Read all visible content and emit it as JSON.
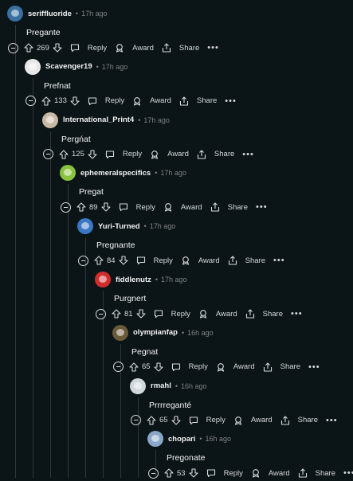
{
  "labels": {
    "reply": "Reply",
    "award": "Award",
    "share": "Share",
    "more": "•••",
    "sep": "•"
  },
  "comments": [
    {
      "user": "seriffluoride",
      "time": "17h ago",
      "text": "Pregante",
      "score": "269",
      "avatar_color": "#3a6fa0"
    },
    {
      "user": "Scavenger19",
      "time": "17h ago",
      "text": "Prefnat",
      "score": "133",
      "avatar_color": "#e8e8e8"
    },
    {
      "user": "International_Print4",
      "time": "17h ago",
      "text": "Pergńat",
      "score": "125",
      "avatar_color": "#c9b9a4"
    },
    {
      "user": "ephemeralspecifics",
      "time": "17h ago",
      "text": "Pregat",
      "score": "89",
      "avatar_color": "#8ac43f"
    },
    {
      "user": "Yuri-Turned",
      "time": "17h ago",
      "text": "Pregnante",
      "score": "84",
      "avatar_color": "#3b78c4"
    },
    {
      "user": "fiddlenutz",
      "time": "17h ago",
      "text": "Purgnert",
      "score": "81",
      "avatar_color": "#d22d2d"
    },
    {
      "user": "olympianfap",
      "time": "16h ago",
      "text": "Pegnat",
      "score": "65",
      "avatar_color": "#6b5a3a"
    },
    {
      "user": "rmahl",
      "time": "16h ago",
      "text": "Prrrreganté",
      "score": "65",
      "avatar_color": "#cfd8dc"
    },
    {
      "user": "chopari",
      "time": "16h ago",
      "text": "Pregonate",
      "score": "53",
      "avatar_color": "#8aa7c9"
    }
  ]
}
